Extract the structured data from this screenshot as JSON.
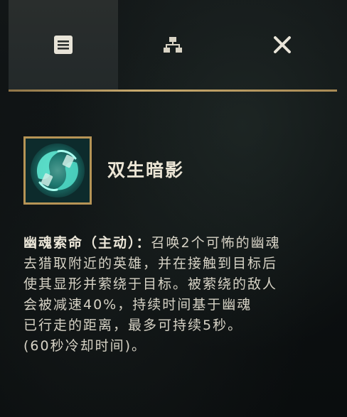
{
  "tabs": [
    {
      "icon": "document-lines-icon",
      "selected": true
    },
    {
      "icon": "hierarchy-tree-icon",
      "selected": false
    },
    {
      "icon": "close-icon",
      "selected": false
    }
  ],
  "ability": {
    "icon": "twin-shadow-ability-icon",
    "name": "双生暗影",
    "description": {
      "part1_strong": "幽魂索命（主动）：",
      "line1_rest": "召唤2个可怖的幽魂",
      "line2": "去猎取附近的英雄，并在接触到目标后",
      "line3": "使其显形并萦绕于目标。被萦绕的敌人",
      "line4": "会被减速40%，持续时间基于幽魂",
      "line5": "已行走的距离，最多可持续5秒。",
      "line6": "(60秒冷却时间)。"
    }
  },
  "colors": {
    "accent_gold": "#c8aa6e",
    "icon_teal": "#3fd6c2",
    "text": "#d6d2c5"
  }
}
